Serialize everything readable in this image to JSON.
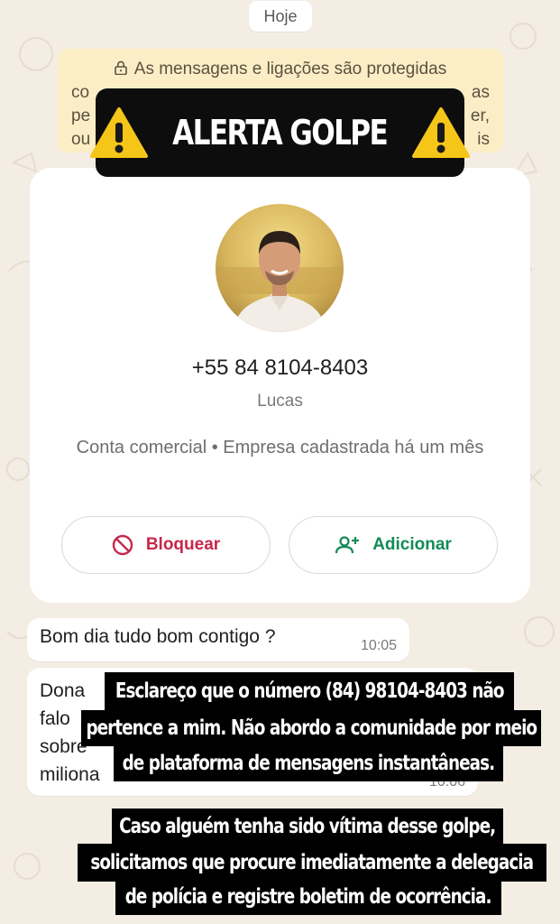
{
  "date_chip": "Hoje",
  "encryption_notice": {
    "line1": "As mensagens e ligações são protegidas",
    "line2_left": "co",
    "line2_right": "as",
    "line3_left": "pe",
    "line3_right": "er,",
    "line4_left": "ou",
    "line4_right": "is"
  },
  "alert_banner": {
    "text": "ALERTA GOLPE"
  },
  "contact_card": {
    "phone": "+55 84 8104-8403",
    "name": "Lucas",
    "business_info": "Conta comercial • Empresa cadastrada há um mês",
    "block_label": "Bloquear",
    "add_label": "Adicionar"
  },
  "messages": [
    {
      "text": "Bom dia tudo bom contigo ?",
      "time": "10:05"
    },
    {
      "lines": [
        "Dona",
        "falo",
        "sobre",
        "miliona"
      ],
      "time": "10:06"
    }
  ],
  "overlay_notes": {
    "disclaimer": [
      "Esclareço que o número (84) 98104-8403 não",
      "pertence a mim. Não abordo a comunidade por meio",
      "de plataforma de mensagens instantâneas."
    ],
    "advice": [
      "Caso alguém tenha sido vítima desse golpe,",
      "solicitamos que procure imediatamente a delegacia",
      "de polícia e registre boletim de ocorrência."
    ]
  },
  "colors": {
    "background": "#f3ede4",
    "notice_bg": "#fbeec6",
    "block_red": "#c5284a",
    "add_green": "#128a58",
    "warning_yellow": "#f5c518"
  },
  "icons": [
    "lock-icon",
    "warning-icon",
    "block-icon",
    "add-person-icon"
  ]
}
